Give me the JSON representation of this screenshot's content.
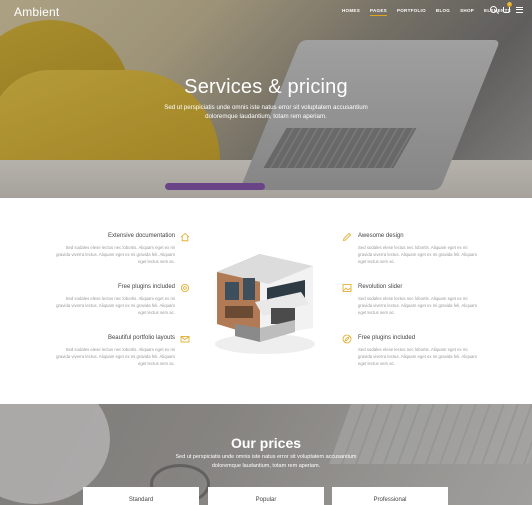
{
  "header": {
    "logo": "Ambient",
    "menu": [
      {
        "label": "HOMES",
        "active": false
      },
      {
        "label": "PAGES",
        "active": true
      },
      {
        "label": "PORTFOLIO",
        "active": false
      },
      {
        "label": "BLOG",
        "active": false
      },
      {
        "label": "SHOP",
        "active": false
      },
      {
        "label": "ELEMENTS",
        "active": false
      }
    ],
    "cart_count": "0",
    "icons": [
      "search-icon",
      "cart-icon",
      "menu-icon"
    ]
  },
  "hero": {
    "title": "Services & pricing",
    "subtitle": "Sed ut perspiciatis unde omnis iste natus error sit voluptatem accusantium doloremque laudantium, totam rem aperiam."
  },
  "features": {
    "left": [
      {
        "title": "Extensive documentation",
        "icon": "home-icon",
        "text": "Sed sodales elese lectus nec lobortis. Aliquam eget ex mi gravida viverra lectus. Aliquam eget ex mi gravida feli. Aliquam eget lectus sem ac."
      },
      {
        "title": "Free plugins included",
        "icon": "gear-icon",
        "text": "Sed sodales elese lectus nec lobortis. Aliquam eget ex mi gravida viverra lectus. Aliquam eget ex mi gravida feli. Aliquam eget lectus sem ac."
      },
      {
        "title": "Beautiful portfolio layouts",
        "icon": "envelope-icon",
        "text": "Sed sodales elese lectus nec lobortis. Aliquam eget ex mi gravida viverra lectus. Aliquam eget ex mi gravida feli. Aliquam eget lectus sem ac."
      }
    ],
    "right": [
      {
        "title": "Awesome design",
        "icon": "pencil-icon",
        "text": "Sed sodales elese lectus nec lobortis. Aliquam eget ex mi gravida viverra lectus. Aliquam eget ex mi gravida feli. Aliquam eget lectus sem ac."
      },
      {
        "title": "Revolution slider",
        "icon": "image-icon",
        "text": "Sed sodales elese lectus nec lobortis. Aliquam eget ex mi gravida viverra lectus. Aliquam eget ex mi gravida feli. Aliquam eget lectus sem ac."
      },
      {
        "title": "Free plugins included",
        "icon": "compass-icon",
        "text": "Sed sodales elese lectus nec lobortis. Aliquam eget ex mi gravida viverra lectus. Aliquam eget ex mi gravida feli. Aliquam eget lectus sem ac."
      }
    ]
  },
  "prices": {
    "title": "Our prices",
    "subtitle": "Sed ut perspiciatis unde omnis iste natus error sit voluptatem accusantium doloremque laudantium, totam rem aperiam.",
    "plans": [
      "Standard",
      "Popular",
      "Professional"
    ]
  },
  "colors": {
    "accent": "#e0a51a"
  }
}
